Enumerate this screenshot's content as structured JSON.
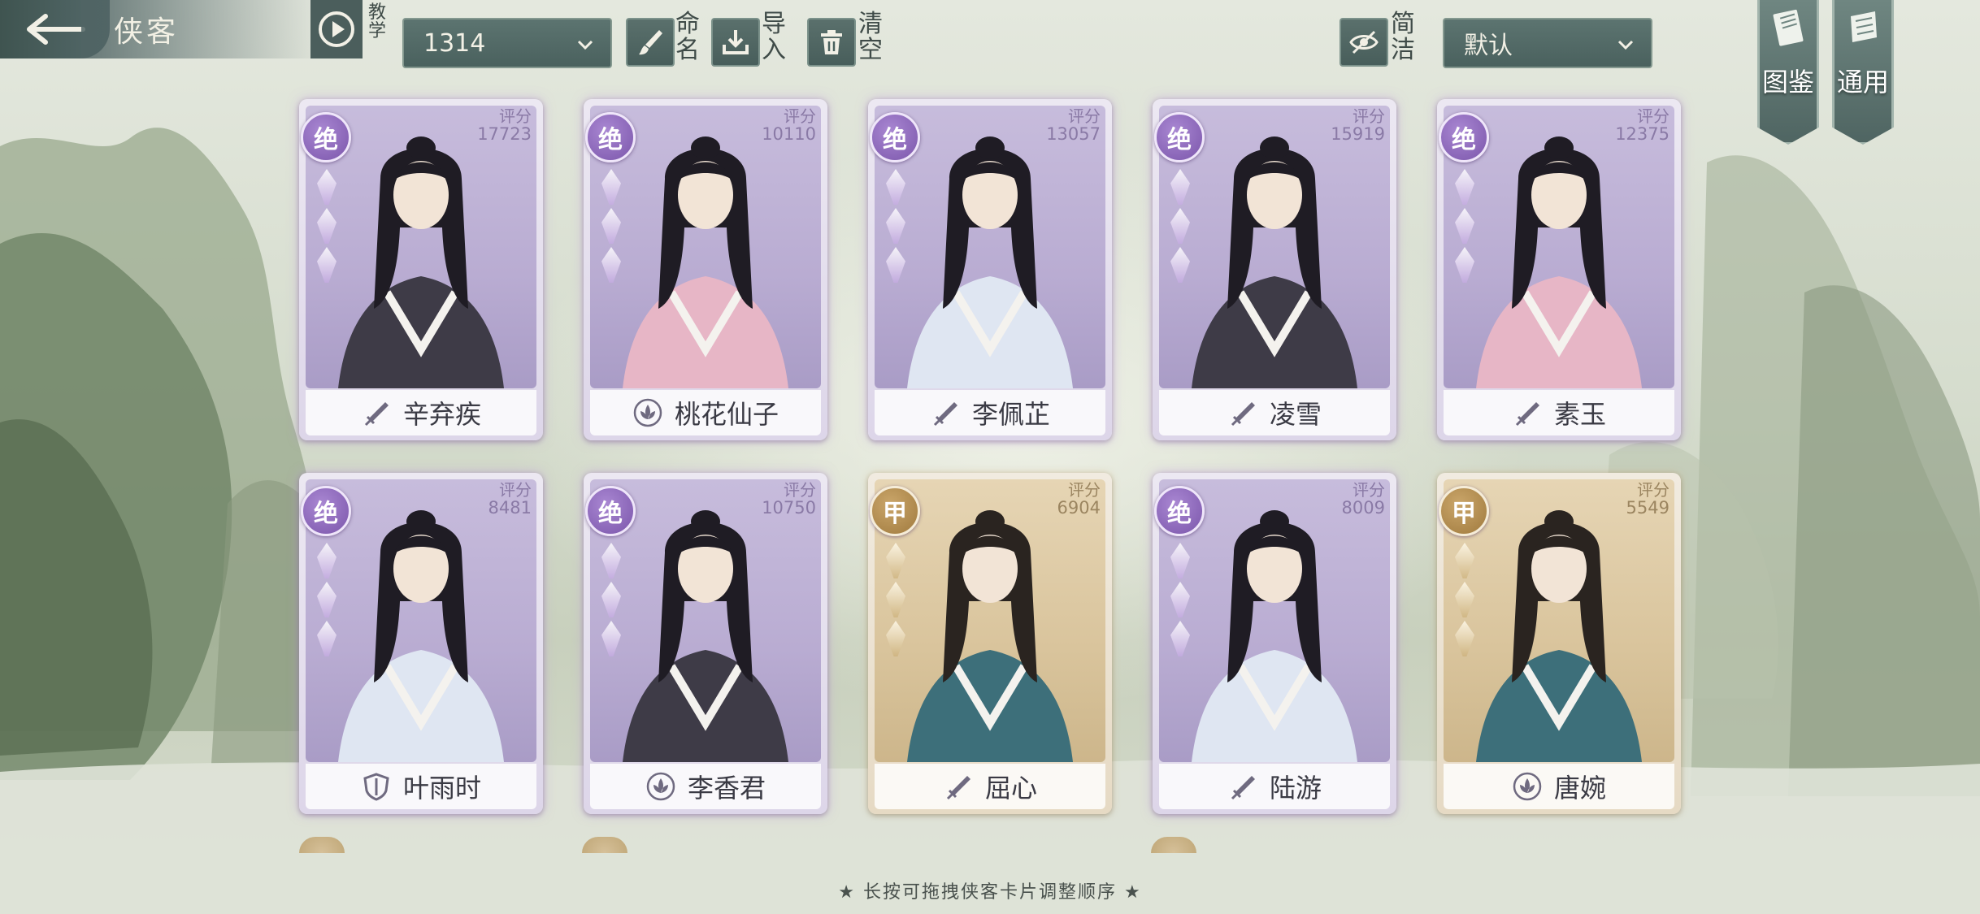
{
  "header": {
    "title": "侠客",
    "tutorial_label": "教学",
    "team_select": "1314",
    "rename_label": "命名",
    "import_label": "导入",
    "clear_label": "清空",
    "simple_label": "简洁",
    "sort_select": "默认",
    "atlas_tab": "图鉴",
    "general_tab": "通用"
  },
  "score_label": "评分",
  "cards": [
    {
      "grade": "绝",
      "score": "17723",
      "name": "辛弃疾",
      "role": "sword",
      "tier": "purple"
    },
    {
      "grade": "绝",
      "score": "10110",
      "name": "桃花仙子",
      "role": "lotus",
      "tier": "purple"
    },
    {
      "grade": "绝",
      "score": "13057",
      "name": "李佩芷",
      "role": "sword",
      "tier": "purple"
    },
    {
      "grade": "绝",
      "score": "15919",
      "name": "凌雪",
      "role": "sword",
      "tier": "purple"
    },
    {
      "grade": "绝",
      "score": "12375",
      "name": "素玉",
      "role": "sword",
      "tier": "purple"
    },
    {
      "grade": "绝",
      "score": "8481",
      "name": "叶雨时",
      "role": "shield",
      "tier": "purple"
    },
    {
      "grade": "绝",
      "score": "10750",
      "name": "李香君",
      "role": "lotus",
      "tier": "purple"
    },
    {
      "grade": "甲",
      "score": "6904",
      "name": "屈心",
      "role": "sword",
      "tier": "gold"
    },
    {
      "grade": "绝",
      "score": "8009",
      "name": "陆游",
      "role": "sword",
      "tier": "purple"
    },
    {
      "grade": "甲",
      "score": "5549",
      "name": "唐婉",
      "role": "lotus",
      "tier": "gold"
    }
  ],
  "footer_hint": "★ 长按可拖拽侠客卡片调整顺序 ★",
  "colors": {
    "accent": "#4f6562",
    "purple_badge": "#7b56ab",
    "gold_badge": "#a07a3e"
  }
}
